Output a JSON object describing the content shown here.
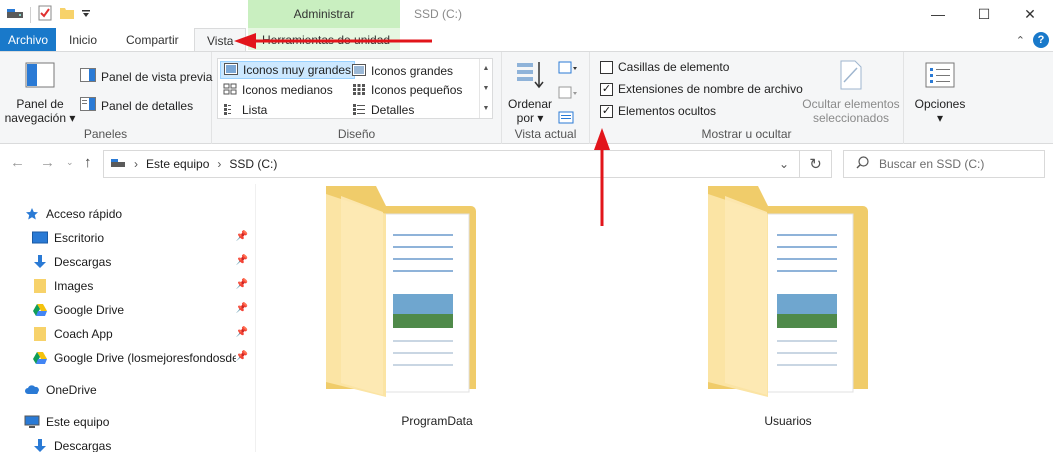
{
  "window": {
    "title": "SSD (C:)",
    "context_tab_group": "Administrar"
  },
  "tabs": {
    "file": "Archivo",
    "home": "Inicio",
    "share": "Compartir",
    "view": "Vista",
    "drive_tools": "Herramientas de unidad"
  },
  "ribbon": {
    "panes": {
      "nav_pane_line1": "Panel de",
      "nav_pane_line2": "navegación",
      "preview": "Panel de vista previa",
      "details": "Panel de detalles",
      "group": "Paneles"
    },
    "layout": {
      "items": [
        "Iconos muy grandes",
        "Iconos grandes",
        "Iconos medianos",
        "Iconos pequeños",
        "Lista",
        "Detalles"
      ],
      "selected": "Iconos muy grandes",
      "group": "Diseño"
    },
    "current_view": {
      "sort_line1": "Ordenar",
      "sort_line2": "por",
      "group": "Vista actual"
    },
    "show_hide": {
      "item_checkboxes": "Casillas de elemento",
      "item_checkboxes_checked": false,
      "file_extensions": "Extensiones de nombre de archivo",
      "file_extensions_checked": true,
      "hidden_items": "Elementos ocultos",
      "hidden_items_checked": true,
      "hide_selected_line1": "Ocultar elementos",
      "hide_selected_line2": "seleccionados",
      "group": "Mostrar u ocultar"
    },
    "options": {
      "label": "Opciones"
    }
  },
  "address": {
    "crumbs": [
      "Este equipo",
      "SSD (C:)"
    ],
    "search_placeholder": "Buscar en SSD (C:)"
  },
  "nav_pane": {
    "quick_access": "Acceso rápido",
    "pinned": [
      "Escritorio",
      "Descargas",
      "Images",
      "Google Drive",
      "Coach App",
      "Google Drive (losmejoresfondosdep"
    ],
    "onedrive": "OneDrive",
    "this_pc": "Este equipo",
    "this_pc_children": [
      "Descargas"
    ]
  },
  "folders": [
    "ProgramData",
    "Usuarios"
  ],
  "colors": {
    "file_tab": "#1979ca",
    "context_tab": "#c9efc0",
    "folder_back": "#f0cc6a",
    "folder_front": "#fbe4a4",
    "annotation_arrow": "#e2151b"
  }
}
